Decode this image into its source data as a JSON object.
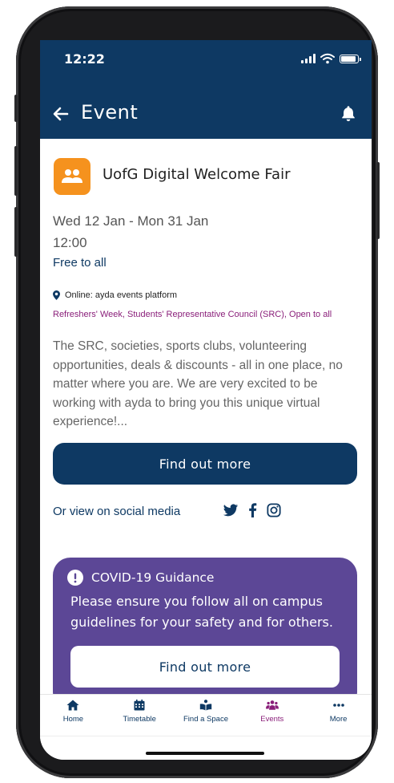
{
  "status_bar": {
    "time": "12:22"
  },
  "header": {
    "title": "Event"
  },
  "event": {
    "title": "UofG Digital Welcome Fair",
    "date": "Wed 12 Jan - Mon 31 Jan",
    "time": "12:00",
    "price": "Free to all",
    "location": "Online: ayda events platform",
    "tags": "Refreshers' Week, Students' Representative Council (SRC), Open to all",
    "description": "The SRC, societies, sports clubs, volunteering opportunities, deals & discounts - all in one place, no matter where you are. We are very excited to be working with ayda to bring you this unique virtual experience!...",
    "cta_label": "Find out more",
    "social_label": "Or view on social media"
  },
  "covid": {
    "title": "COVID-19 Guidance",
    "body": "Please ensure you follow all on campus guidelines for your safety and for others.",
    "button_label": "Find out more"
  },
  "tabs": [
    {
      "label": "Home",
      "icon": "home-icon"
    },
    {
      "label": "Timetable",
      "icon": "calendar-icon"
    },
    {
      "label": "Find a Space",
      "icon": "reading-icon"
    },
    {
      "label": "Events",
      "icon": "people-icon",
      "active": true
    },
    {
      "label": "More",
      "icon": "more-icon"
    }
  ],
  "colors": {
    "primary": "#0e3963",
    "accent": "#f5921e",
    "covid": "#5c4796",
    "tag": "#8a1f7a"
  }
}
